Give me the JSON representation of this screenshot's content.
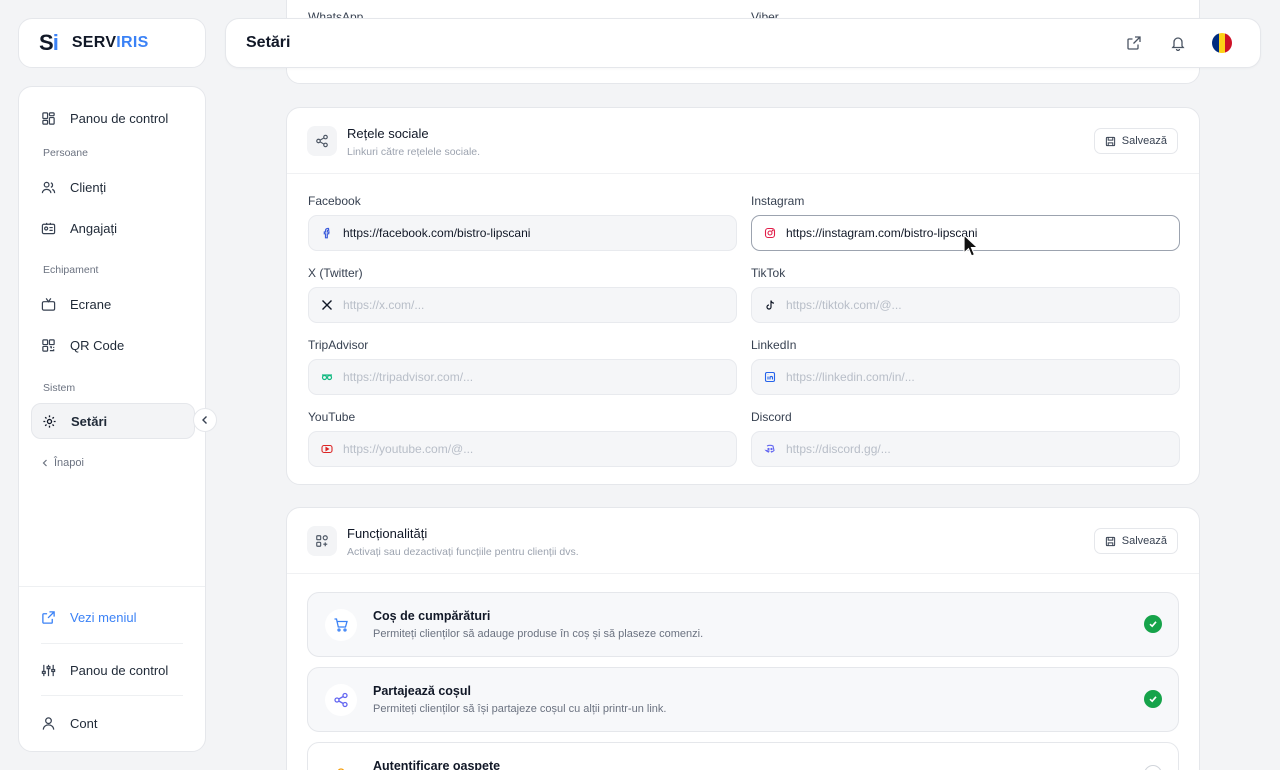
{
  "brand": {
    "mark_s": "S",
    "mark_i": "i",
    "name_a": "SERV",
    "name_b": "IRIS"
  },
  "header": {
    "title": "Setări"
  },
  "sidebar": {
    "items": [
      {
        "label": "Panou de control",
        "icon": "dashboard-icon"
      },
      {
        "section": "Persoane"
      },
      {
        "label": "Clienți",
        "icon": "users-icon"
      },
      {
        "label": "Angajați",
        "icon": "id-card-icon"
      },
      {
        "section": "Echipament"
      },
      {
        "label": "Ecrane",
        "icon": "tv-icon"
      },
      {
        "label": "QR Code",
        "icon": "qr-icon"
      },
      {
        "section": "Sistem"
      },
      {
        "label": "Setări",
        "icon": "gear-icon",
        "active": true
      }
    ],
    "back_label": "Înapoi",
    "bottom": [
      {
        "label": "Vezi meniul",
        "icon": "external-link-icon",
        "color": "#3b82f6"
      },
      {
        "label": "Panou de control",
        "icon": "sliders-icon"
      },
      {
        "label": "Cont",
        "icon": "user-icon"
      }
    ]
  },
  "top_partial": {
    "left_label": "WhatsApp",
    "right_label": "Viber"
  },
  "social": {
    "title": "Rețele sociale",
    "subtitle": "Linkuri către rețelele sociale.",
    "save_label": "Salvează",
    "fields": [
      {
        "label": "Facebook",
        "value": "https://facebook.com/bistro-lipscani",
        "placeholder": "",
        "icon": "facebook-icon"
      },
      {
        "label": "Instagram",
        "value": "https://instagram.com/bistro-lipscani",
        "placeholder": "",
        "icon": "instagram-icon"
      },
      {
        "label": "X (Twitter)",
        "value": "",
        "placeholder": "https://x.com/...",
        "icon": "x-icon"
      },
      {
        "label": "TikTok",
        "value": "",
        "placeholder": "https://tiktok.com/@...",
        "icon": "tiktok-icon"
      },
      {
        "label": "TripAdvisor",
        "value": "",
        "placeholder": "https://tripadvisor.com/...",
        "icon": "tripadvisor-icon"
      },
      {
        "label": "LinkedIn",
        "value": "",
        "placeholder": "https://linkedin.com/in/...",
        "icon": "linkedin-icon"
      },
      {
        "label": "YouTube",
        "value": "",
        "placeholder": "https://youtube.com/@...",
        "icon": "youtube-icon"
      },
      {
        "label": "Discord",
        "value": "",
        "placeholder": "https://discord.gg/...",
        "icon": "discord-icon"
      }
    ]
  },
  "features": {
    "title": "Funcționalități",
    "subtitle": "Activați sau dezactivați funcțiile pentru clienții dvs.",
    "save_label": "Salvează",
    "items": [
      {
        "title": "Coș de cumpărături",
        "desc": "Permiteți clienților să adauge produse în coș și să plaseze comenzi.",
        "enabled": true,
        "icon": "cart-icon"
      },
      {
        "title": "Partajează coșul",
        "desc": "Permiteți clienților să își partajeze coșul cu alții printr-un link.",
        "enabled": true,
        "icon": "share-icon"
      },
      {
        "title": "Autentificare oaspete",
        "desc": "",
        "enabled": false,
        "icon": "guest-icon"
      }
    ]
  },
  "colors": {
    "accent": "#3b82f6",
    "success": "#16a34a",
    "flag": [
      "#002b7f",
      "#fcd116",
      "#ce1126"
    ]
  }
}
